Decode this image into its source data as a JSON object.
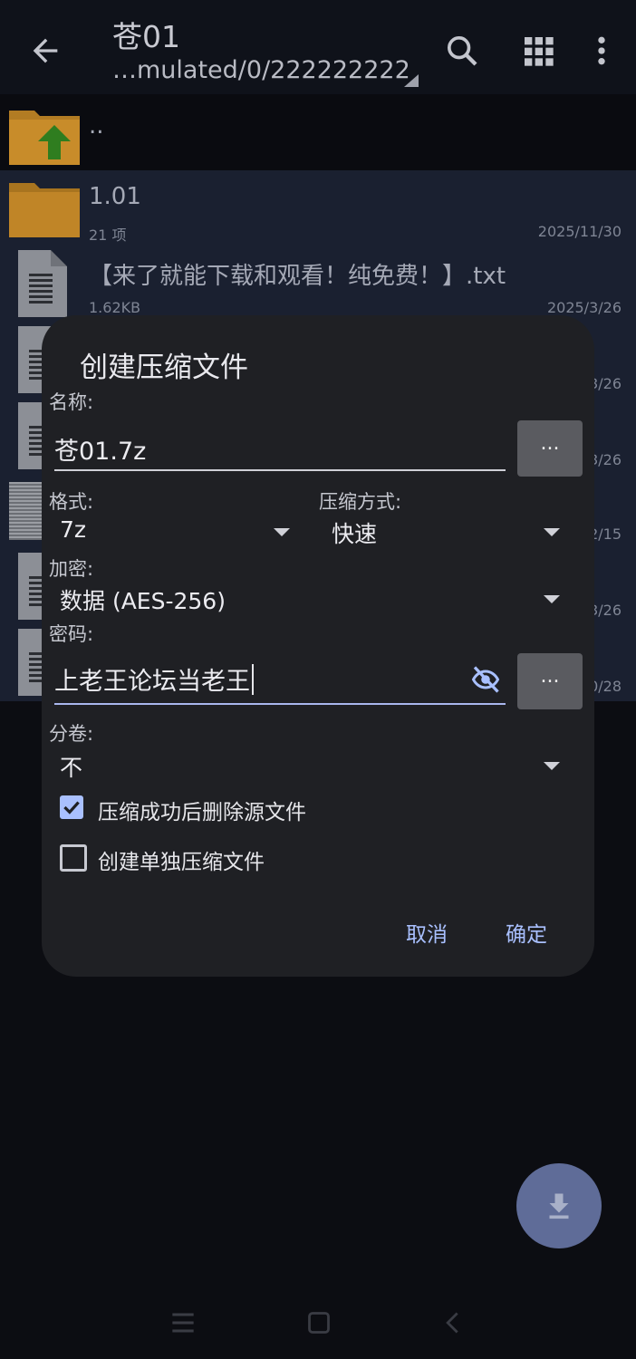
{
  "appbar": {
    "title": "苍01",
    "path": "…mulated/0/222222222",
    "icons": [
      "back-arrow-icon",
      "search-icon",
      "grid-view-icon",
      "more-vert-icon"
    ]
  },
  "files": [
    {
      "name": "..",
      "type": "parent-folder"
    },
    {
      "name": "1.01",
      "meta": "21 项",
      "date": "2025/11/30",
      "type": "folder"
    },
    {
      "name": "【来了就能下载和观看！纯免费！】.txt",
      "meta": "1.62KB",
      "date": "2025/3/26",
      "type": "document"
    },
    {
      "date_partial": "3/26"
    },
    {
      "date_partial": "3/26"
    },
    {
      "date_partial": "2/15"
    },
    {
      "date_partial": "3/26"
    },
    {
      "date_partial": "0/28"
    }
  ],
  "dialog": {
    "title": "创建压缩文件",
    "name_label": "名称:",
    "name_value": "苍01.7z",
    "more_label": "...",
    "format_label": "格式:",
    "format_value": "7z",
    "method_label": "压缩方式:",
    "method_value": "快速",
    "encrypt_label": "加密:",
    "encrypt_value": "数据 (AES-256)",
    "password_label": "密码:",
    "password_value": "上老王论坛当老王",
    "split_label": "分卷:",
    "split_value": "不",
    "delete_source_label": "压缩成功后删除源文件",
    "delete_source_checked": true,
    "separate_label": "创建单独压缩文件",
    "separate_checked": false,
    "cancel_label": "取消",
    "ok_label": "确定"
  },
  "colors": {
    "accent": "#a9c0ff",
    "dialog_bg": "#1f2024",
    "folder": "#e3a73a"
  }
}
